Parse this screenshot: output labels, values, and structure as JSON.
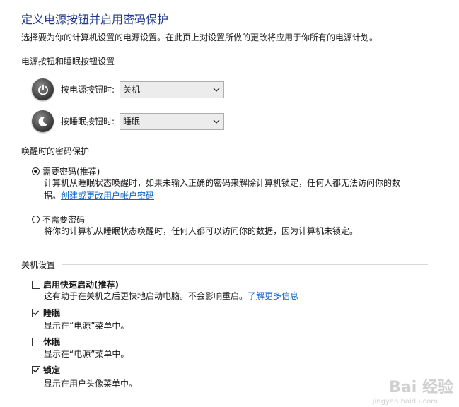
{
  "page": {
    "title": "定义电源按钮并启用密码保护",
    "description": "选择要为你的计算机设置的电源设置。在此页上对设置所做的更改将应用于你所有的电源计划。"
  },
  "power_buttons": {
    "section_title": "电源按钮和睡眠按钮设置",
    "power_label": "按电源按钮时:",
    "power_value": "关机",
    "sleep_label": "按睡眠按钮时:",
    "sleep_value": "睡眠"
  },
  "password": {
    "section_title": "唤醒时的密码保护",
    "require_label": "需要密码(推荐)",
    "require_desc": "计算机从睡眠状态唤醒时，如果未输入正确的密码来解除计算机锁定，任何人都无法访问你的数",
    "require_desc2": "据。",
    "require_link": "创建或更改用户帐户密码",
    "require_checked": true,
    "norequire_label": "不需要密码",
    "norequire_desc": "将你的计算机从睡眠状态唤醒时，任何人都可以访问你的数据，因为计算机未锁定。",
    "norequire_checked": false
  },
  "shutdown": {
    "section_title": "关机设置",
    "fast_label": "启用快速启动(推荐)",
    "fast_desc": "这有助于在关机之后更快地启动电脑。不会影响重启。",
    "fast_link": "了解更多信息",
    "fast_checked": false,
    "sleep_label": "睡眠",
    "sleep_desc": "显示在“电源”菜单中。",
    "sleep_checked": true,
    "hibernate_label": "休眠",
    "hibernate_desc": "显示在“电源”菜单中。",
    "hibernate_checked": false,
    "lock_label": "锁定",
    "lock_desc": "显示在用户头像菜单中。",
    "lock_checked": true
  },
  "watermark": {
    "text": "Bai 经验",
    "url": "jingyan.baidu.com"
  }
}
